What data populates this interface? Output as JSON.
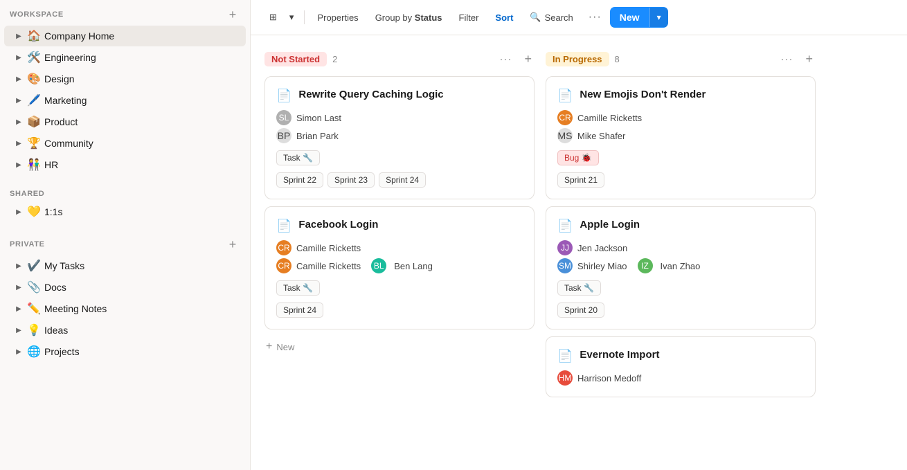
{
  "sidebar": {
    "workspace_label": "WORKSPACE",
    "shared_label": "SHARED",
    "private_label": "PRIVATE",
    "workspace_items": [
      {
        "id": "company-home",
        "icon": "🏠",
        "label": "Company Home",
        "active": true
      },
      {
        "id": "engineering",
        "icon": "🛠️",
        "label": "Engineering",
        "active": false
      },
      {
        "id": "design",
        "icon": "🎨",
        "label": "Design",
        "active": false
      },
      {
        "id": "marketing",
        "icon": "🖊️",
        "label": "Marketing",
        "active": false
      },
      {
        "id": "product",
        "icon": "📦",
        "label": "Product",
        "active": false
      },
      {
        "id": "community",
        "icon": "🏆",
        "label": "Community",
        "active": false
      },
      {
        "id": "hr",
        "icon": "👫",
        "label": "HR",
        "active": false
      }
    ],
    "shared_items": [
      {
        "id": "1on1s",
        "icon": "💛",
        "label": "1:1s",
        "active": false
      }
    ],
    "private_items": [
      {
        "id": "my-tasks",
        "icon": "✔️",
        "label": "My Tasks",
        "active": false
      },
      {
        "id": "docs",
        "icon": "📎",
        "label": "Docs",
        "active": false
      },
      {
        "id": "meeting-notes",
        "icon": "✏️",
        "label": "Meeting Notes",
        "active": false
      },
      {
        "id": "ideas",
        "icon": "💡",
        "label": "Ideas",
        "active": false
      },
      {
        "id": "projects",
        "icon": "🌐",
        "label": "Projects",
        "active": false
      }
    ]
  },
  "toolbar": {
    "view_icon": "⊞",
    "properties_label": "Properties",
    "group_by_label": "Group by",
    "group_by_field": "Status",
    "filter_label": "Filter",
    "sort_label": "Sort",
    "search_label": "Search",
    "more_label": "···",
    "new_label": "New",
    "dropdown_icon": "▾"
  },
  "board": {
    "columns": [
      {
        "id": "not-started",
        "status_label": "Not Started",
        "status_class": "not-started",
        "count": 2,
        "cards": [
          {
            "id": "card-1",
            "title": "Rewrite Query Caching Logic",
            "doc_icon": "📄",
            "people": [
              {
                "name": "Simon Last",
                "avatar": "SL",
                "av_class": "av-gray"
              },
              {
                "name": "Brian Park",
                "avatar": "BP",
                "av_class": "av-face"
              }
            ],
            "tags": [
              {
                "label": "Task 🔧",
                "class": ""
              }
            ],
            "sprints": [
              "Sprint 22",
              "Sprint 23",
              "Sprint 24"
            ]
          },
          {
            "id": "card-2",
            "title": "Facebook Login",
            "doc_icon": "📄",
            "people": [
              {
                "name": "Camille Ricketts",
                "avatar": "CR",
                "av_class": "av-orange"
              },
              {
                "name": "Camille Ricketts",
                "avatar": "CR",
                "av_class": "av-orange"
              },
              {
                "name": "Ben Lang",
                "avatar": "BL",
                "av_class": "av-teal"
              }
            ],
            "tags": [
              {
                "label": "Task 🔧",
                "class": ""
              }
            ],
            "sprints": [
              "Sprint 24"
            ],
            "multi_person_row": true
          }
        ],
        "new_label": "New"
      },
      {
        "id": "in-progress",
        "status_label": "In Progress",
        "status_class": "in-progress",
        "count": 8,
        "cards": [
          {
            "id": "card-3",
            "title": "New Emojis Don't Render",
            "doc_icon": "📄",
            "people": [
              {
                "name": "Camille Ricketts",
                "avatar": "CR",
                "av_class": "av-orange"
              },
              {
                "name": "Mike Shafer",
                "avatar": "MS",
                "av_class": "av-face"
              }
            ],
            "tags": [
              {
                "label": "Bug 🐞",
                "class": "bug"
              }
            ],
            "sprints": [
              "Sprint 21"
            ]
          },
          {
            "id": "card-4",
            "title": "Apple Login",
            "doc_icon": "📄",
            "people": [
              {
                "name": "Jen Jackson",
                "avatar": "JJ",
                "av_class": "av-purple"
              },
              {
                "name": "Shirley Miao",
                "avatar": "SM",
                "av_class": "av-blue"
              },
              {
                "name": "Ivan Zhao",
                "avatar": "IZ",
                "av_class": "av-green"
              }
            ],
            "tags": [
              {
                "label": "Task 🔧",
                "class": ""
              }
            ],
            "sprints": [
              "Sprint 20"
            ],
            "multi_person_row2": true
          },
          {
            "id": "card-5",
            "title": "Evernote Import",
            "doc_icon": "📄",
            "people": [
              {
                "name": "Harrison Medoff",
                "avatar": "HM",
                "av_class": "av-red"
              }
            ],
            "tags": [],
            "sprints": []
          }
        ]
      }
    ]
  }
}
